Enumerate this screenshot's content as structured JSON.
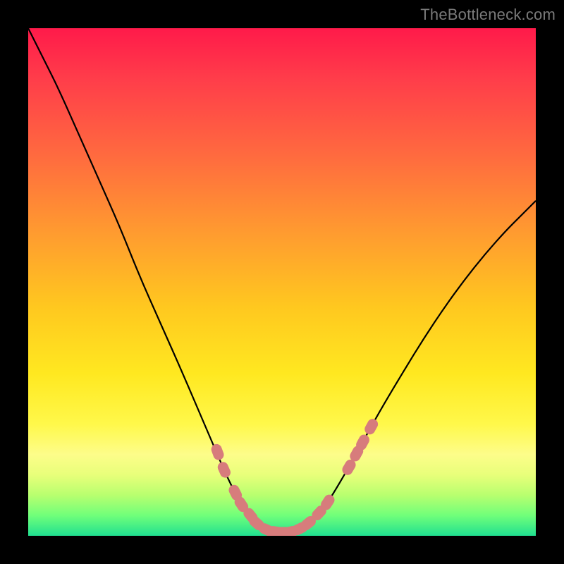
{
  "watermark": "TheBottleneck.com",
  "colors": {
    "background": "#000000",
    "gradient_top": "#ff1a4a",
    "gradient_bottom": "#20e090",
    "curve": "#000000",
    "marker": "#d77c7c"
  },
  "chart_data": {
    "type": "line",
    "title": "",
    "xlabel": "",
    "ylabel": "",
    "xlim": [
      0,
      100
    ],
    "ylim": [
      0,
      100
    ],
    "grid": false,
    "comment": "axes are implicit percentages of the plot area; curve and markers are given as (x%, y%) where y% is measured from top of plot",
    "curve_points": [
      [
        0.0,
        0.0
      ],
      [
        3.0,
        6.0
      ],
      [
        6.0,
        12.0
      ],
      [
        10.0,
        21.0
      ],
      [
        14.0,
        30.0
      ],
      [
        18.0,
        39.0
      ],
      [
        22.0,
        49.0
      ],
      [
        26.0,
        58.0
      ],
      [
        30.0,
        67.0
      ],
      [
        33.0,
        74.0
      ],
      [
        36.0,
        81.0
      ],
      [
        39.0,
        88.0
      ],
      [
        41.0,
        92.0
      ],
      [
        43.0,
        95.0
      ],
      [
        45.0,
        97.5
      ],
      [
        47.0,
        98.8
      ],
      [
        49.0,
        99.3
      ],
      [
        51.0,
        99.3
      ],
      [
        53.0,
        98.8
      ],
      [
        55.0,
        97.8
      ],
      [
        57.0,
        96.0
      ],
      [
        59.0,
        93.4
      ],
      [
        61.0,
        90.2
      ],
      [
        64.0,
        85.0
      ],
      [
        67.0,
        79.5
      ],
      [
        70.0,
        74.2
      ],
      [
        74.0,
        67.5
      ],
      [
        78.0,
        61.0
      ],
      [
        82.0,
        55.0
      ],
      [
        86.0,
        49.5
      ],
      [
        90.0,
        44.5
      ],
      [
        94.0,
        40.0
      ],
      [
        97.0,
        37.0
      ],
      [
        100.0,
        34.0
      ]
    ],
    "markers": [
      [
        37.3,
        83.5
      ],
      [
        38.6,
        87.0
      ],
      [
        40.8,
        91.5
      ],
      [
        42.0,
        93.8
      ],
      [
        43.8,
        96.0
      ],
      [
        45.0,
        97.5
      ],
      [
        47.0,
        98.8
      ],
      [
        48.7,
        99.2
      ],
      [
        50.2,
        99.3
      ],
      [
        51.7,
        99.2
      ],
      [
        53.5,
        98.6
      ],
      [
        55.2,
        97.5
      ],
      [
        57.3,
        95.5
      ],
      [
        59.0,
        93.4
      ],
      [
        63.2,
        86.5
      ],
      [
        64.7,
        83.8
      ],
      [
        65.9,
        81.6
      ],
      [
        67.6,
        78.5
      ]
    ]
  }
}
